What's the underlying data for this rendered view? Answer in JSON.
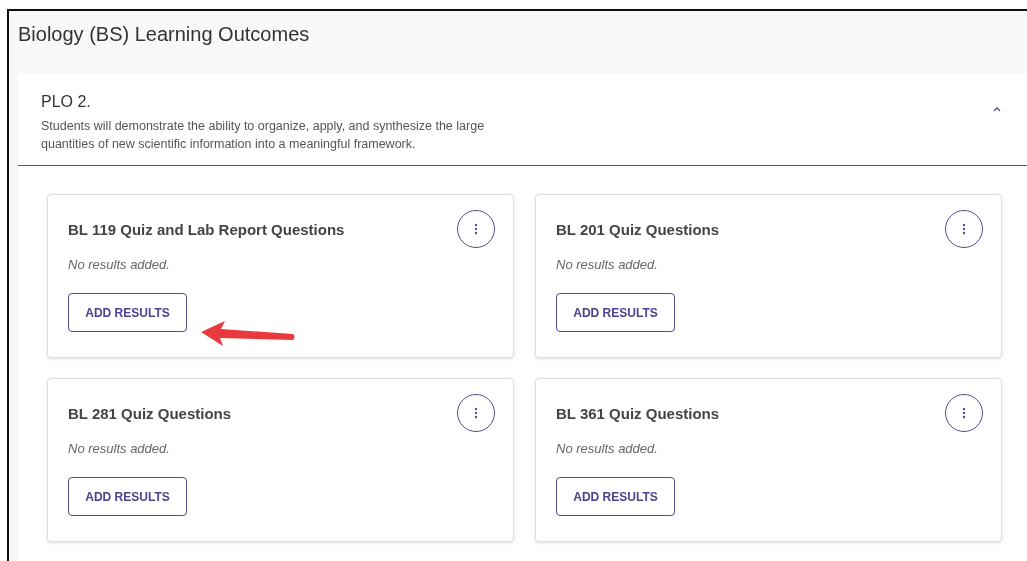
{
  "page": {
    "title": "Biology (BS) Learning Outcomes"
  },
  "outcome": {
    "label": "PLO 2.",
    "description": "Students will demonstrate the ability to organize, apply, and synthesize the large quantities of new scientific information into a meaningful framework.",
    "expanded": true
  },
  "cards": [
    {
      "title": "BL 119 Quiz and Lab Report Questions",
      "status": "No results added.",
      "button": "ADD RESULTS"
    },
    {
      "title": "BL 201 Quiz Questions",
      "status": "No results added.",
      "button": "ADD RESULTS"
    },
    {
      "title": "BL 281 Quiz Questions",
      "status": "No results added.",
      "button": "ADD RESULTS"
    },
    {
      "title": "BL 361 Quiz Questions",
      "status": "No results added.",
      "button": "ADD RESULTS"
    }
  ]
}
